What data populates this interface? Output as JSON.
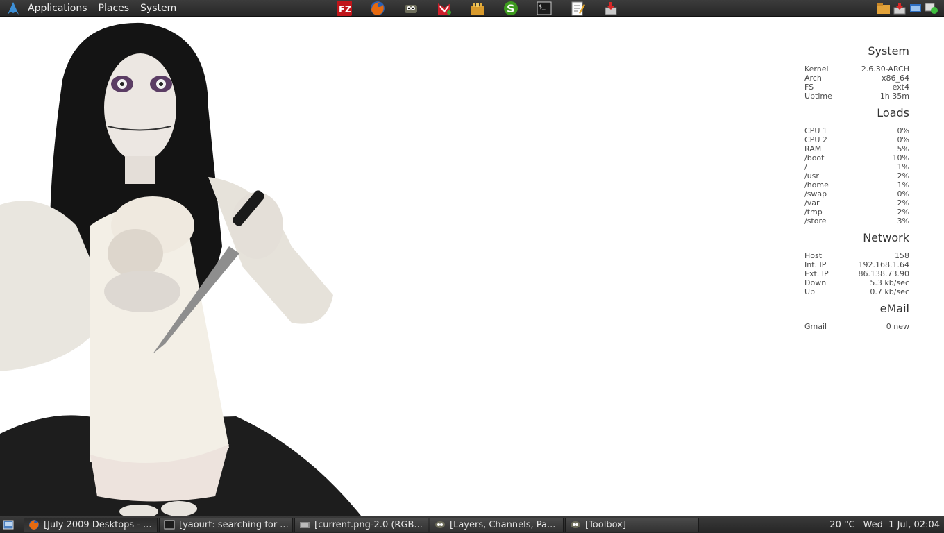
{
  "top_panel": {
    "menus": [
      "Applications",
      "Places",
      "System"
    ],
    "launchers": [
      "filezilla-icon",
      "firefox-icon",
      "gimp-icon",
      "mail-icon",
      "archive-icon",
      "skype-icon",
      "terminal-icon",
      "text-editor-icon",
      "installer-icon"
    ],
    "tray": [
      "folder-icon",
      "download-icon",
      "network-icon",
      "status-icon"
    ]
  },
  "conky": {
    "system": {
      "heading": "System",
      "rows": [
        {
          "label": "Kernel",
          "value": "2.6.30-ARCH"
        },
        {
          "label": "Arch",
          "value": "x86_64"
        },
        {
          "label": "FS",
          "value": "ext4"
        },
        {
          "label": "Uptime",
          "value": "1h 35m"
        }
      ]
    },
    "loads": {
      "heading": "Loads",
      "rows": [
        {
          "label": "CPU 1",
          "value": "0%"
        },
        {
          "label": "CPU 2",
          "value": "0%"
        },
        {
          "label": "RAM",
          "value": "5%"
        },
        {
          "label": "/boot",
          "value": "10%"
        },
        {
          "label": "/",
          "value": "1%"
        },
        {
          "label": "/usr",
          "value": "2%"
        },
        {
          "label": "/home",
          "value": "1%"
        },
        {
          "label": "/swap",
          "value": "0%"
        },
        {
          "label": "/var",
          "value": "2%"
        },
        {
          "label": "/tmp",
          "value": "2%"
        },
        {
          "label": "/store",
          "value": "3%"
        }
      ]
    },
    "network": {
      "heading": "Network",
      "rows": [
        {
          "label": "Host",
          "value": "158"
        },
        {
          "label": "Int. IP",
          "value": "192.168.1.64"
        },
        {
          "label": "Ext. IP",
          "value": "86.138.73.90"
        },
        {
          "label": "Down",
          "value": "5.3 kb/sec"
        },
        {
          "label": "Up",
          "value": "0.7 kb/sec"
        }
      ]
    },
    "email": {
      "heading": "eMail",
      "rows": [
        {
          "label": "Gmail",
          "value": "0 new"
        }
      ]
    }
  },
  "taskbar": {
    "tasks": [
      {
        "icon": "firefox-icon",
        "label": "[July 2009 Desktops - ..."
      },
      {
        "icon": "terminal-icon",
        "label": "[yaourt: searching for ..."
      },
      {
        "icon": "image-window-icon",
        "label": "[current.png-2.0 (RGB..."
      },
      {
        "icon": "gimp-icon",
        "label": "[Layers, Channels, Pa..."
      },
      {
        "icon": "gimp-icon",
        "label": "[Toolbox]"
      }
    ],
    "temperature": "20 °C",
    "clock": "Wed  1 Jul, 02:04"
  },
  "colors": {
    "panel": "#2f2f2f",
    "panel_text": "#f0f0f0",
    "conky_text": "#4a4a4a",
    "desktop": "#ffffff"
  }
}
